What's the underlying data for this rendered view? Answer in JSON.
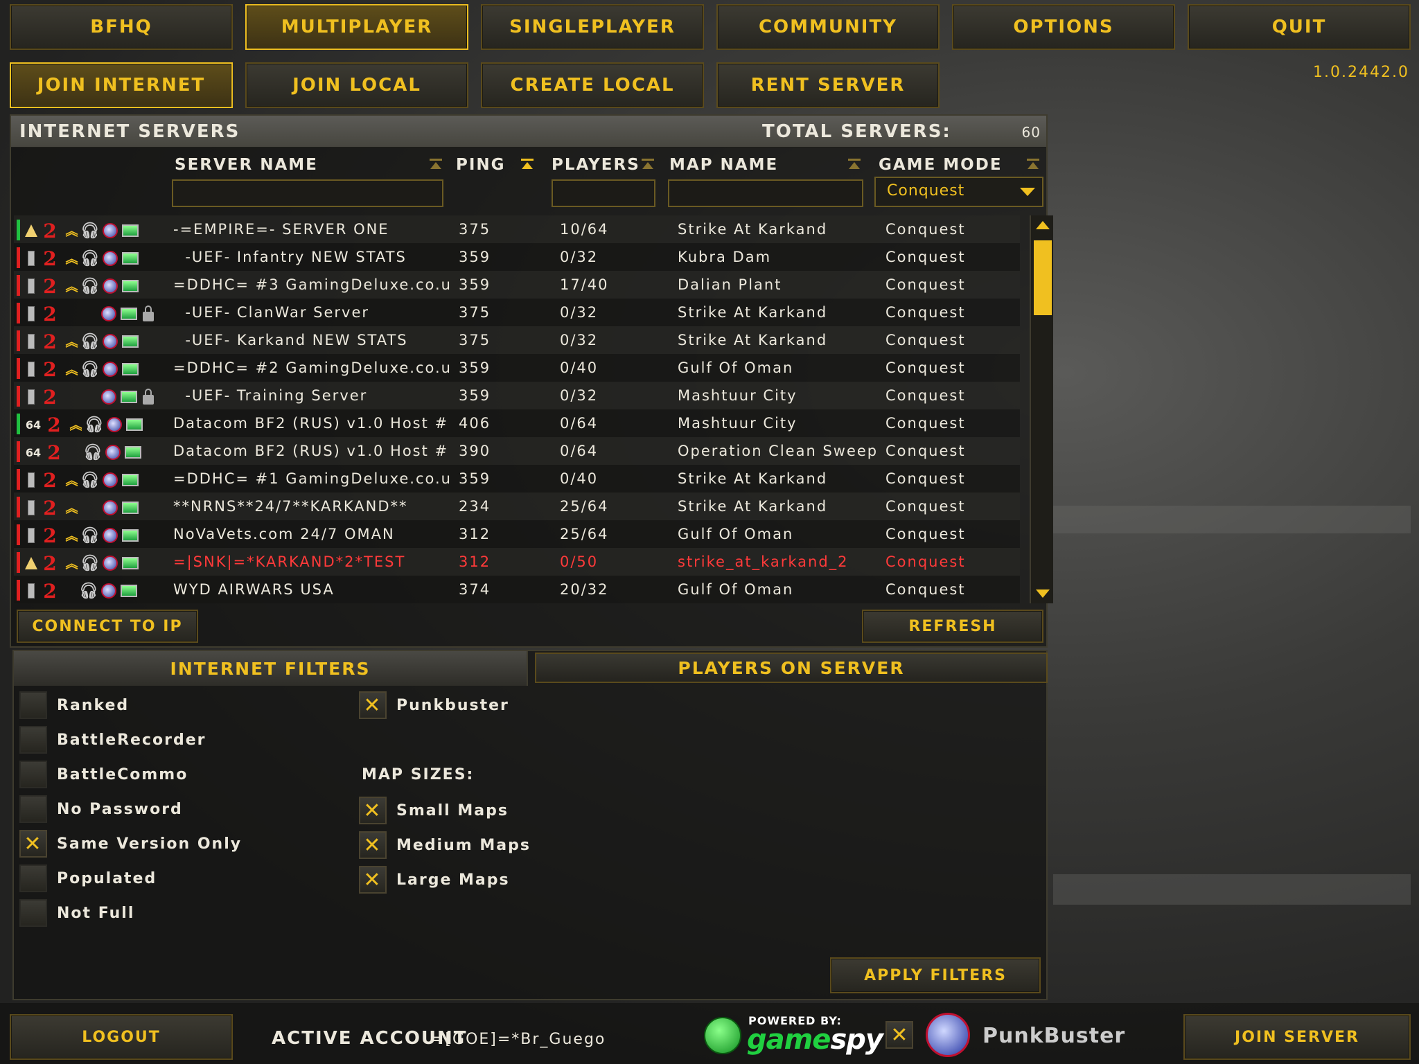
{
  "top_nav": [
    "BFHQ",
    "MULTIPLAYER",
    "SINGLEPLAYER",
    "COMMUNITY",
    "OPTIONS",
    "QUIT"
  ],
  "sub_nav": [
    "JOIN INTERNET",
    "JOIN LOCAL",
    "CREATE LOCAL",
    "RENT SERVER"
  ],
  "version": "1.0.2442.0",
  "server_panel": {
    "title": "INTERNET SERVERS",
    "total_label": "TOTAL SERVERS:",
    "total_value": "60",
    "columns": {
      "server_name": "SERVER NAME",
      "ping": "PING",
      "players": "PLAYERS",
      "map_name": "MAP NAME",
      "game_mode": "GAME MODE"
    },
    "game_mode_filter": "Conquest",
    "rows": [
      {
        "name": "-=EMPIRE=- SERVER ONE",
        "ping": "375",
        "players": "10/64",
        "map": "Strike At Karkand",
        "mode": "Conquest"
      },
      {
        "name": "  -UEF- Infantry NEW STATS",
        "ping": "359",
        "players": "0/32",
        "map": "Kubra Dam",
        "mode": "Conquest"
      },
      {
        "name": "=DDHC= #3 GamingDeluxe.co.u",
        "ping": "359",
        "players": "17/40",
        "map": "Dalian Plant",
        "mode": "Conquest"
      },
      {
        "name": "  -UEF- ClanWar Server",
        "ping": "375",
        "players": "0/32",
        "map": "Strike At Karkand",
        "mode": "Conquest"
      },
      {
        "name": "  -UEF- Karkand NEW STATS",
        "ping": "375",
        "players": "0/32",
        "map": "Strike At Karkand",
        "mode": "Conquest"
      },
      {
        "name": "=DDHC= #2 GamingDeluxe.co.u",
        "ping": "359",
        "players": "0/40",
        "map": "Gulf Of Oman",
        "mode": "Conquest"
      },
      {
        "name": "  -UEF- Training Server",
        "ping": "359",
        "players": "0/32",
        "map": "Mashtuur City",
        "mode": "Conquest"
      },
      {
        "name": "Datacom BF2 (RUS) v1.0 Host #",
        "ping": "406",
        "players": "0/64",
        "map": "Mashtuur City",
        "mode": "Conquest"
      },
      {
        "name": "Datacom BF2 (RUS) v1.0 Host #",
        "ping": "390",
        "players": "0/64",
        "map": "Operation Clean Sweep",
        "mode": "Conquest"
      },
      {
        "name": "=DDHC= #1 GamingDeluxe.co.u",
        "ping": "359",
        "players": "0/40",
        "map": "Strike At Karkand",
        "mode": "Conquest"
      },
      {
        "name": "**NRNS**24/7**KARKAND**",
        "ping": "234",
        "players": "25/64",
        "map": "Strike At Karkand",
        "mode": "Conquest"
      },
      {
        "name": "NoVaVets.com 24/7 OMAN",
        "ping": "312",
        "players": "25/64",
        "map": "Gulf Of Oman",
        "mode": "Conquest"
      },
      {
        "name": "=|SNK|=*KARKAND*2*TEST",
        "ping": "312",
        "players": "0/50",
        "map": "strike_at_karkand_2",
        "mode": "Conquest"
      },
      {
        "name": "WYD AIRWARS USA",
        "ping": "374",
        "players": "20/32",
        "map": "Gulf Of Oman",
        "mode": "Conquest"
      }
    ],
    "connect_to_ip": "CONNECT TO IP",
    "refresh": "REFRESH"
  },
  "filters": {
    "tab_filters": "INTERNET FILTERS",
    "tab_players": "PLAYERS ON SERVER",
    "left_options": [
      {
        "label": "Ranked",
        "checked": false
      },
      {
        "label": "BattleRecorder",
        "checked": false
      },
      {
        "label": "BattleCommo",
        "checked": false
      },
      {
        "label": "No Password",
        "checked": false
      },
      {
        "label": "Same Version Only",
        "checked": true
      },
      {
        "label": "Populated",
        "checked": false
      },
      {
        "label": "Not Full",
        "checked": false
      }
    ],
    "punkbuster": {
      "label": "Punkbuster",
      "checked": true
    },
    "map_sizes_label": "MAP SIZES:",
    "map_sizes": [
      {
        "label": "Small Maps",
        "checked": true
      },
      {
        "label": "Medium Maps",
        "checked": true
      },
      {
        "label": "Large Maps",
        "checked": true
      }
    ],
    "apply": "APPLY FILTERS"
  },
  "bottom": {
    "logout": "LOGOUT",
    "active_account_label": "ACTIVE ACCOUNT",
    "active_account_value": "=[GOE]=*Br_Guego",
    "gamespy_powered": "POWERED BY:",
    "gamespy_brand_a": "game",
    "gamespy_brand_b": "spy",
    "punkbuster_text": "PunkBuster",
    "join_server": "JOIN SERVER"
  },
  "check_mark": "✕",
  "colors": {
    "accent": "#f0c020",
    "highlight_row": "#ff3a3a"
  }
}
